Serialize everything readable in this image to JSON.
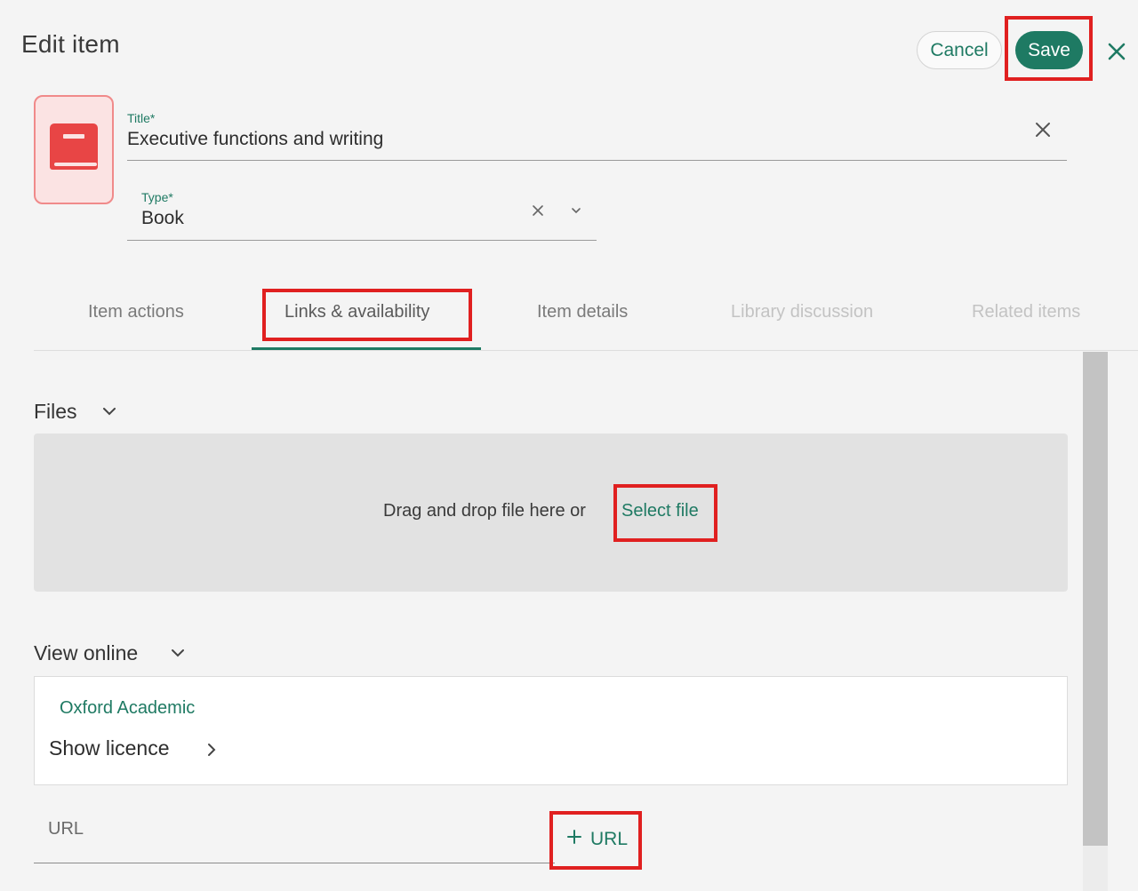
{
  "header": {
    "title": "Edit item",
    "cancel_label": "Cancel",
    "save_label": "Save"
  },
  "item": {
    "title_label": "Title*",
    "title_value": "Executive functions and writing",
    "type_label": "Type*",
    "type_value": "Book"
  },
  "tabs": [
    {
      "label": "Item actions",
      "state": "normal"
    },
    {
      "label": "Links & availability",
      "state": "active"
    },
    {
      "label": "Item details",
      "state": "normal"
    },
    {
      "label": "Library discussion",
      "state": "disabled"
    },
    {
      "label": "Related items",
      "state": "disabled"
    }
  ],
  "files": {
    "section_label": "Files",
    "drop_text": "Drag and drop file here or",
    "select_file_label": "Select file"
  },
  "view_online": {
    "section_label": "View online",
    "provider": "Oxford Academic",
    "show_licence_label": "Show licence"
  },
  "url": {
    "label": "URL",
    "add_label": "URL"
  },
  "colors": {
    "accent": "#1e7a63",
    "highlight": "#e02020",
    "book_icon": "#e84545"
  },
  "icons": {
    "close": "close-icon",
    "clear": "clear-icon",
    "chevron_down": "chevron-down-icon",
    "chevron_right": "chevron-right-icon",
    "book": "book-icon",
    "plus": "plus-icon"
  }
}
